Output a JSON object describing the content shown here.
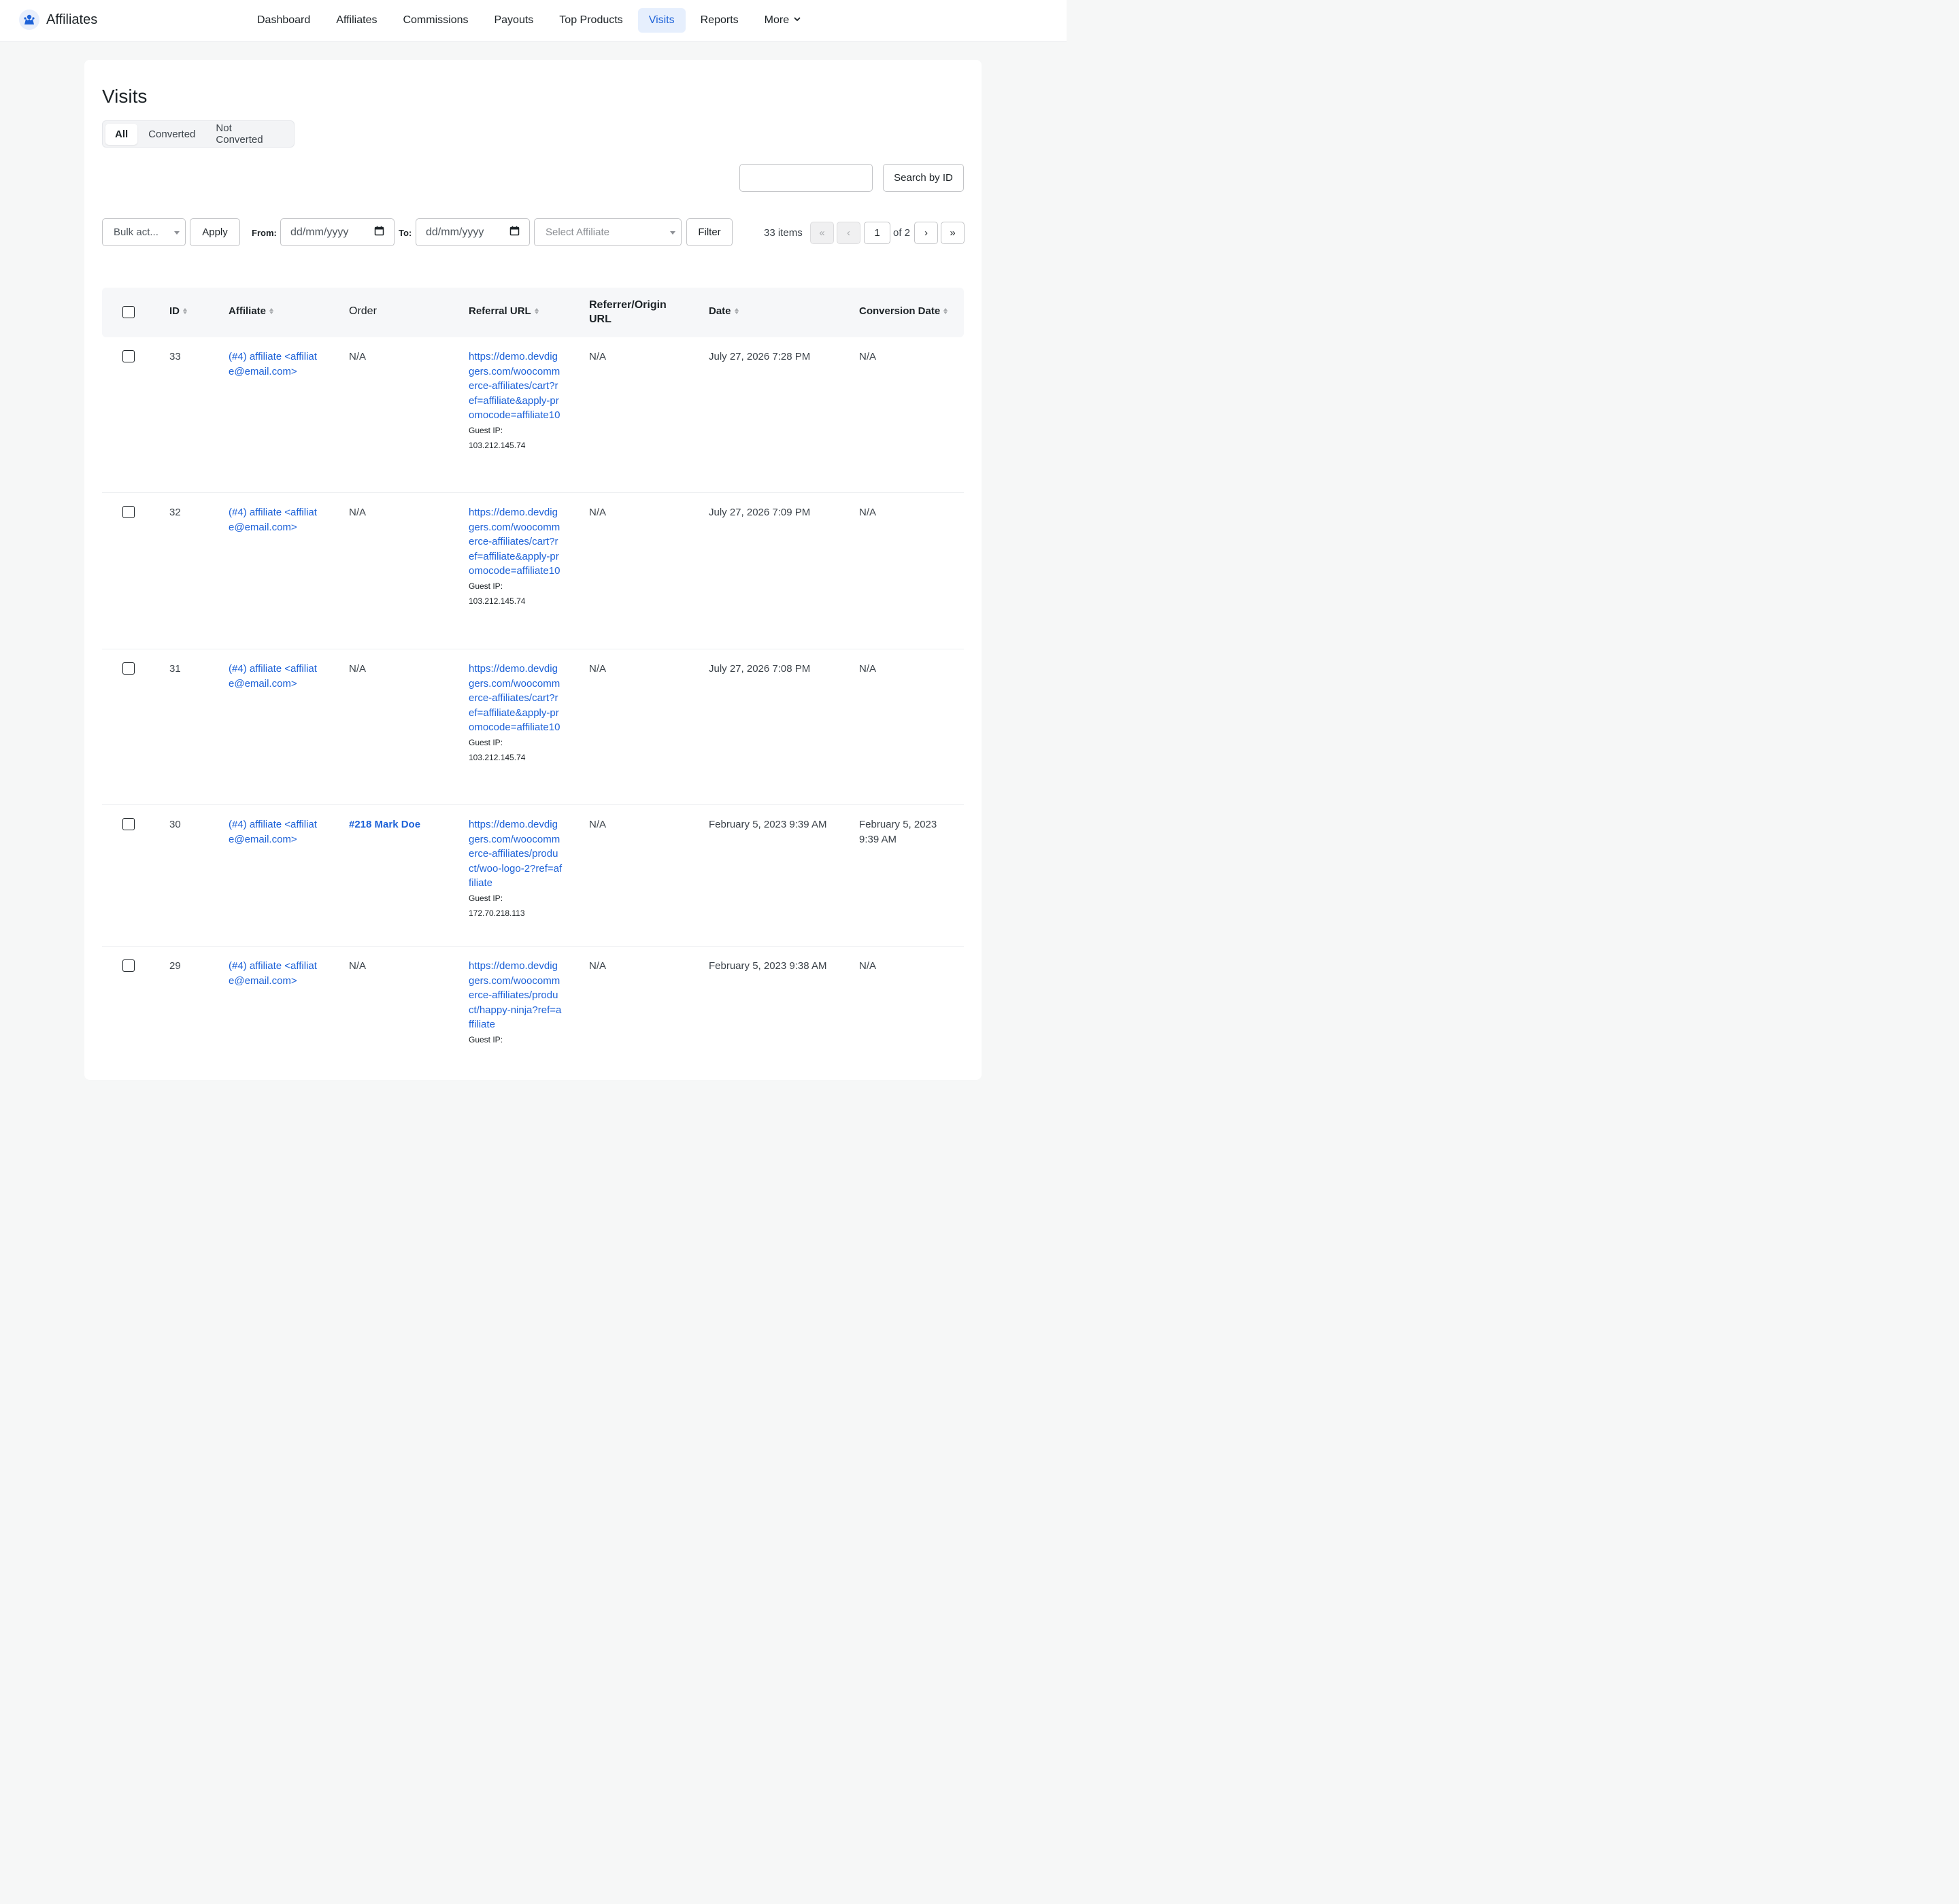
{
  "brand": {
    "name": "Affiliates",
    "accent": "#1d62d8"
  },
  "nav": [
    {
      "label": "Dashboard",
      "active": false
    },
    {
      "label": "Affiliates",
      "active": false
    },
    {
      "label": "Commissions",
      "active": false
    },
    {
      "label": "Payouts",
      "active": false
    },
    {
      "label": "Top Products",
      "active": false
    },
    {
      "label": "Visits",
      "active": true
    },
    {
      "label": "Reports",
      "active": false
    },
    {
      "label": "More",
      "active": false
    }
  ],
  "page": {
    "title": "Visits"
  },
  "tabs": [
    {
      "label": "All",
      "active": true
    },
    {
      "label": "Converted",
      "active": false
    },
    {
      "label": "Not Converted",
      "active": false
    }
  ],
  "search": {
    "value": "",
    "button": "Search by ID"
  },
  "filters": {
    "bulk_actions": "Bulk act...",
    "apply": "Apply",
    "from_label": "From:",
    "from_placeholder": "dd/mm/yyyy",
    "to_label": "To:",
    "to_placeholder": "dd/mm/yyyy",
    "affiliate_placeholder": "Select Affiliate",
    "filter": "Filter"
  },
  "pagination": {
    "items": "33 items",
    "first": "«",
    "prev": "‹",
    "current": "1",
    "of": "of 2",
    "next": "›",
    "last": "»"
  },
  "table": {
    "columns": {
      "id": "ID",
      "affiliate": "Affiliate",
      "order": "Order",
      "referral_url": "Referral URL",
      "referrer": "Referrer/Origin URL",
      "date": "Date",
      "conversion_date": "Conversion Date"
    },
    "rows": [
      {
        "id": "33",
        "affiliate": "(#4) affiliate <affiliate@email.com>",
        "order": "N/A",
        "order_is_link": false,
        "referral_url": "https://demo.devdiggers.com/woocommerce-affiliates/cart?ref=affiliate&apply-promocode=affiliate10",
        "guest_ip_label": "Guest IP:",
        "guest_ip": "103.212.145.74",
        "referrer": "N/A",
        "date": "July 27, 2026 7:28 PM",
        "conversion_date": "N/A"
      },
      {
        "id": "32",
        "affiliate": "(#4) affiliate <affiliate@email.com>",
        "order": "N/A",
        "order_is_link": false,
        "referral_url": "https://demo.devdiggers.com/woocommerce-affiliates/cart?ref=affiliate&apply-promocode=affiliate10",
        "guest_ip_label": "Guest IP:",
        "guest_ip": "103.212.145.74",
        "referrer": "N/A",
        "date": "July 27, 2026 7:09 PM",
        "conversion_date": "N/A"
      },
      {
        "id": "31",
        "affiliate": "(#4) affiliate <affiliate@email.com>",
        "order": "N/A",
        "order_is_link": false,
        "referral_url": "https://demo.devdiggers.com/woocommerce-affiliates/cart?ref=affiliate&apply-promocode=affiliate10",
        "guest_ip_label": "Guest IP:",
        "guest_ip": "103.212.145.74",
        "referrer": "N/A",
        "date": "July 27, 2026 7:08 PM",
        "conversion_date": "N/A"
      },
      {
        "id": "30",
        "affiliate": "(#4) affiliate <affiliate@email.com>",
        "order": "#218 Mark Doe",
        "order_is_link": true,
        "referral_url": "https://demo.devdiggers.com/woocommerce-affiliates/product/woo-logo-2?ref=affiliate",
        "guest_ip_label": "Guest IP:",
        "guest_ip": "172.70.218.113",
        "referrer": "N/A",
        "date": "February 5, 2023 9:39 AM",
        "conversion_date": "February 5, 2023 9:39 AM"
      },
      {
        "id": "29",
        "affiliate": "(#4) affiliate <affiliate@email.com>",
        "order": "N/A",
        "order_is_link": false,
        "referral_url": "https://demo.devdiggers.com/woocommerce-affiliates/product/happy-ninja?ref=affiliate",
        "guest_ip_label": "Guest IP:",
        "guest_ip": "",
        "referrer": "N/A",
        "date": "February 5, 2023 9:38 AM",
        "conversion_date": "N/A"
      }
    ]
  }
}
